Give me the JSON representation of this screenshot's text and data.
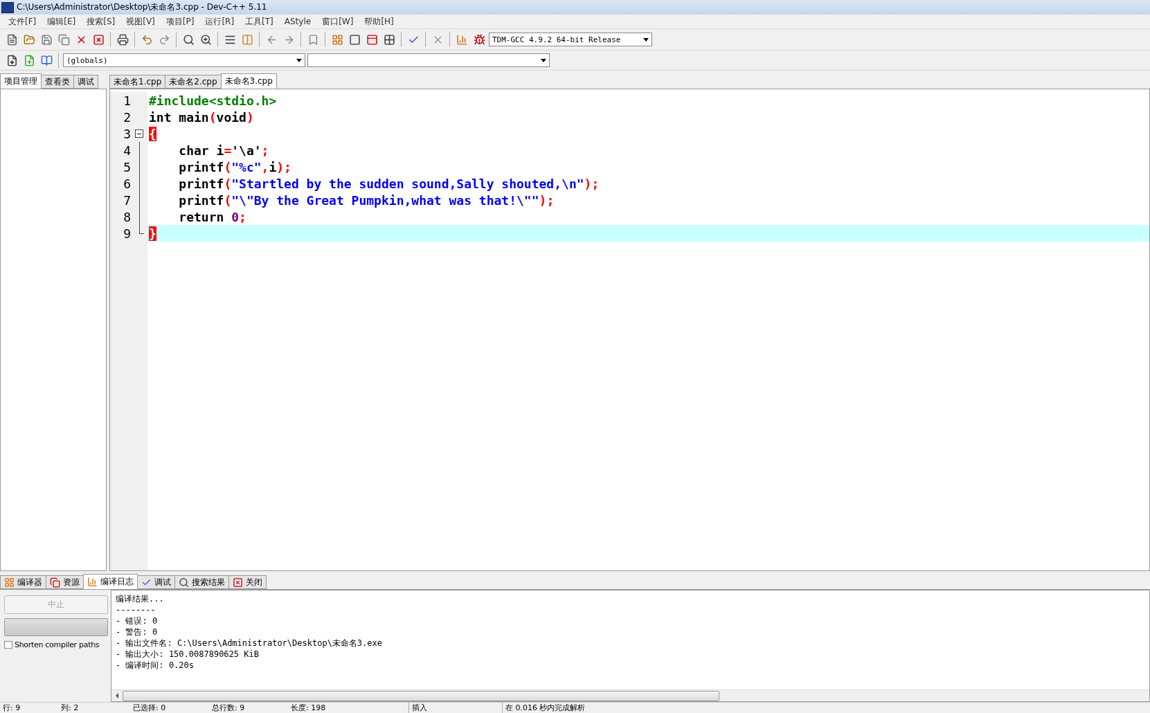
{
  "window": {
    "title": "C:\\Users\\Administrator\\Desktop\\未命名3.cpp - Dev-C++ 5.11"
  },
  "menu": [
    "文件[F]",
    "编辑[E]",
    "搜索[S]",
    "视图[V]",
    "项目[P]",
    "运行[R]",
    "工具[T]",
    "AStyle",
    "窗口[W]",
    "帮助[H]"
  ],
  "toolbar": {
    "compiler": "TDM-GCC 4.9.2 64-bit Release"
  },
  "toolbar2": {
    "scope": "(globals)"
  },
  "left_tabs": [
    {
      "label": "项目管理",
      "selected": true
    },
    {
      "label": "查看类",
      "selected": false
    },
    {
      "label": "调试",
      "selected": false
    }
  ],
  "editor_tabs": [
    {
      "label": "未命名1.cpp",
      "selected": false
    },
    {
      "label": "未命名2.cpp",
      "selected": false
    },
    {
      "label": "未命名3.cpp",
      "selected": true
    }
  ],
  "editor": {
    "lines": [
      {
        "number": "1",
        "kind": "plain",
        "current": false,
        "tokens": [
          {
            "text": "#include<stdio.h>",
            "kind": "preproc"
          }
        ]
      },
      {
        "number": "2",
        "kind": "plain",
        "current": false,
        "tokens": [
          {
            "text": "int main",
            "kind": "plain"
          },
          {
            "text": "(",
            "kind": "symbol"
          },
          {
            "text": "void",
            "kind": "plain"
          },
          {
            "text": ")",
            "kind": "symbol"
          }
        ]
      },
      {
        "number": "3",
        "kind": "start",
        "current": false,
        "tokens": [
          {
            "text": "{",
            "kind": "brace"
          }
        ]
      },
      {
        "number": "4",
        "kind": "body",
        "current": false,
        "tokens": [
          {
            "text": "    char i",
            "kind": "plain"
          },
          {
            "text": "=",
            "kind": "symbol"
          },
          {
            "text": "'\\a'",
            "kind": "plain"
          },
          {
            "text": ";",
            "kind": "symbol"
          }
        ]
      },
      {
        "number": "5",
        "kind": "body",
        "current": false,
        "tokens": [
          {
            "text": "    printf",
            "kind": "plain"
          },
          {
            "text": "(",
            "kind": "symbol"
          },
          {
            "text": "\"%c\"",
            "kind": "string"
          },
          {
            "text": ",",
            "kind": "symbol"
          },
          {
            "text": "i",
            "kind": "plain"
          },
          {
            "text": ");",
            "kind": "symbol"
          }
        ]
      },
      {
        "number": "6",
        "kind": "body",
        "current": false,
        "tokens": [
          {
            "text": "    printf",
            "kind": "plain"
          },
          {
            "text": "(",
            "kind": "symbol"
          },
          {
            "text": "\"Startled by the sudden sound,Sally shouted,\\n\"",
            "kind": "string"
          },
          {
            "text": ");",
            "kind": "symbol"
          }
        ]
      },
      {
        "number": "7",
        "kind": "body",
        "current": false,
        "tokens": [
          {
            "text": "    printf",
            "kind": "plain"
          },
          {
            "text": "(",
            "kind": "symbol"
          },
          {
            "text": "\"\\\"By the Great Pumpkin,what was that!\\\"\"",
            "kind": "string"
          },
          {
            "text": ");",
            "kind": "symbol"
          }
        ]
      },
      {
        "number": "8",
        "kind": "body",
        "current": false,
        "tokens": [
          {
            "text": "    return ",
            "kind": "plain"
          },
          {
            "text": "0",
            "kind": "number"
          },
          {
            "text": ";",
            "kind": "symbol"
          }
        ]
      },
      {
        "number": "9",
        "kind": "end",
        "current": true,
        "tokens": [
          {
            "text": "}",
            "kind": "brace"
          }
        ]
      }
    ]
  },
  "bottom_tabs": [
    {
      "label": "编译器",
      "selected": false
    },
    {
      "label": "资源",
      "selected": false
    },
    {
      "label": "编译日志",
      "selected": true
    },
    {
      "label": "调试",
      "selected": false
    },
    {
      "label": "搜索结果",
      "selected": false
    },
    {
      "label": "关闭",
      "selected": false
    }
  ],
  "compile_panel": {
    "abort_button": "中止",
    "abort_disabled": true,
    "progress": {
      "level": 0
    },
    "shorten_paths": {
      "label": "Shorten compiler paths",
      "checked": false
    },
    "log": [
      "编译结果...",
      "--------",
      "- 错误: 0",
      "- 警告: 0",
      "- 输出文件名: C:\\Users\\Administrator\\Desktop\\未命名3.exe",
      "- 输出大小: 150.0087890625 KiB",
      "- 编译时间: 0.20s"
    ]
  },
  "status_bar": [
    "行: 9",
    "列: 2",
    "已选择: 0",
    "总行数: 9",
    "长度: 198",
    "插入",
    "在 0.016 秒内完成解析"
  ]
}
